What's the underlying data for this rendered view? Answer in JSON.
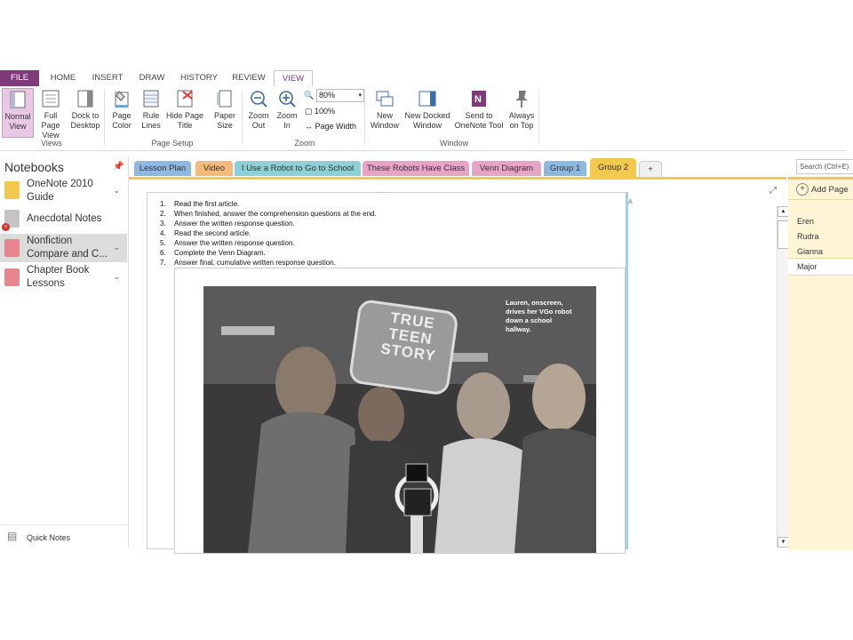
{
  "ribbon_tabs": {
    "file": "FILE",
    "home": "HOME",
    "insert": "INSERT",
    "draw": "DRAW",
    "history": "HISTORY",
    "review": "REVIEW",
    "view": "VIEW"
  },
  "views_group": {
    "normal_view": "Normal View",
    "full_page_view": "Full Page View",
    "dock_to_desktop": "Dock to Desktop",
    "label": "Views"
  },
  "page_setup_group": {
    "page_color": "Page Color",
    "rule_lines": "Rule Lines",
    "hide_page_title": "Hide Page Title",
    "paper_size": "Paper Size",
    "label": "Page Setup"
  },
  "zoom_group": {
    "zoom_out": "Zoom Out",
    "zoom_in": "Zoom In",
    "zoom_value": "80%",
    "hundred": "100%",
    "page_width": "Page Width",
    "label": "Zoom"
  },
  "window_group": {
    "new_window": "New Window",
    "new_docked_window": "New Docked Window",
    "send_to_onenote": "Send to OneNote Tool",
    "always_on_top": "Always on Top",
    "label": "Window"
  },
  "nav": {
    "title": "Notebooks",
    "notebooks": [
      {
        "name": "OneNote 2010 Guide",
        "color": "#f2c94c"
      },
      {
        "name": "Anecdotal Notes",
        "color": "#b9b9b9"
      },
      {
        "name": "Nonfiction Compare and C...",
        "color": "#e8868f"
      },
      {
        "name": "Chapter Book Lessons",
        "color": "#e8868f"
      }
    ],
    "quick_notes": "Quick Notes"
  },
  "section_tabs": [
    {
      "label": "Lesson Plan",
      "color": "#8fb8de"
    },
    {
      "label": "Video",
      "color": "#f5b97a"
    },
    {
      "label": "I Use a Robot to Go to School",
      "color": "#8ed0d8"
    },
    {
      "label": "These Robots Have Class",
      "color": "#e8a3c9"
    },
    {
      "label": "Venn Diagram",
      "color": "#e8a3c9"
    },
    {
      "label": "Group 1",
      "color": "#8fb8de"
    },
    {
      "label": "Group 2",
      "color": "#f2c94c"
    }
  ],
  "add_section": "+",
  "page": {
    "steps": [
      {
        "n": "1.",
        "text": "Read the first article."
      },
      {
        "n": "2.",
        "text": "When finished, answer the comprehension questions at the end."
      },
      {
        "n": "3.",
        "text": "Answer the written response question."
      },
      {
        "n": "4.",
        "text": "Read the second article."
      },
      {
        "n": "5.",
        "text": "Answer the written response question."
      },
      {
        "n": "6.",
        "text": "Complete the Venn Diagram."
      },
      {
        "n": "7.",
        "text": "Answer final, cumulative written response question."
      }
    ],
    "photo_sign_line1": "TRUE",
    "photo_sign_line2": "TEEN",
    "photo_sign_line3": "STORY",
    "photo_caption": "Lauren, onscreen, drives her VGo robot down a school hallway."
  },
  "pages_pane": {
    "search_placeholder": "Search (Ctrl+E)",
    "add_page": "Add Page",
    "pages": [
      "Eren",
      "Rudra",
      "Gianna",
      "Major"
    ]
  }
}
